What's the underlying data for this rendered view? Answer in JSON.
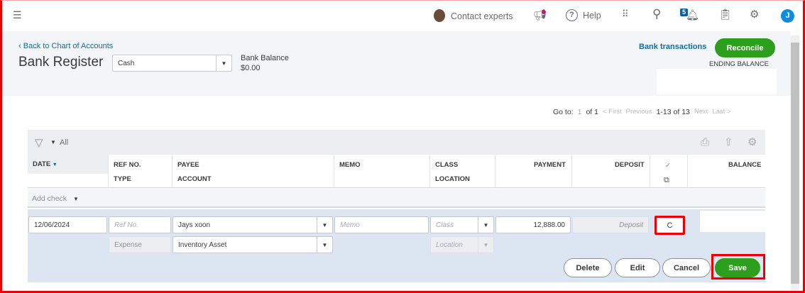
{
  "topbar": {
    "contact_experts": "Contact experts",
    "help": "Help",
    "notification_count": "5",
    "avatar_initial": "J"
  },
  "header": {
    "back_link": "Back to Chart of Accounts",
    "title": "Bank Register",
    "account_select": "Cash",
    "bank_balance_label": "Bank Balance",
    "bank_balance_value": "$0.00",
    "bank_transactions": "Bank transactions",
    "reconcile": "Reconcile",
    "ending_balance_label": "ENDING BALANCE"
  },
  "pagination": {
    "goto_label": "Go to:",
    "page": "1",
    "of_pages": "of 1",
    "first": "< First",
    "previous": "Previous",
    "range": "1-13 of 13",
    "next": "Next",
    "last": "Last >"
  },
  "filter": {
    "label": "All"
  },
  "columns": {
    "date": "DATE",
    "ref": "REF NO.",
    "type": "TYPE",
    "payee": "PAYEE",
    "account": "ACCOUNT",
    "memo": "MEMO",
    "class": "CLASS",
    "location": "LOCATION",
    "payment": "PAYMENT",
    "deposit": "DEPOSIT",
    "check": "✓",
    "balance": "BALANCE"
  },
  "add_check": "Add check",
  "edit_row": {
    "date": "12/06/2024",
    "ref_placeholder": "Ref No.",
    "payee": "Jays xoon",
    "memo_placeholder": "Memo",
    "class_placeholder": "Class",
    "payment": "12,888.00",
    "deposit_placeholder": "Deposit",
    "cleared": "C",
    "type": "Expense",
    "account": "Inventory Asset",
    "location_placeholder": "Location"
  },
  "actions": {
    "delete": "Delete",
    "edit": "Edit",
    "cancel": "Cancel",
    "save": "Save"
  },
  "colors": {
    "accent_green": "#2ca01c",
    "link_blue": "#0b6ea7",
    "highlight_red": "#e00000",
    "edit_row_bg": "#dce6f2"
  }
}
